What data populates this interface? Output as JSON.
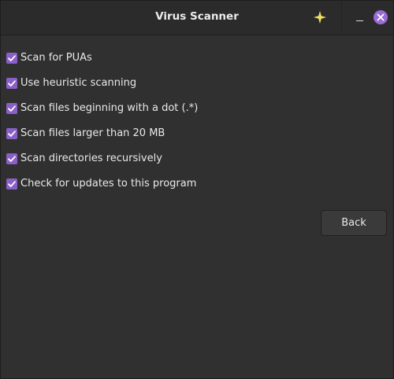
{
  "window": {
    "title": "Virus Scanner",
    "accent_color": "#8a5fc8",
    "titlebar_icons": [
      "sparkle-icon",
      "minimize-icon",
      "close-icon"
    ]
  },
  "options": [
    {
      "label": "Scan for PUAs",
      "checked": true
    },
    {
      "label": "Use heuristic scanning",
      "checked": true
    },
    {
      "label": "Scan files beginning with a dot (.*)",
      "checked": true
    },
    {
      "label": "Scan files larger than 20 MB",
      "checked": true
    },
    {
      "label": "Scan directories recursively",
      "checked": true
    },
    {
      "label": "Check for updates to this program",
      "checked": true
    }
  ],
  "actions": {
    "back_label": "Back"
  }
}
